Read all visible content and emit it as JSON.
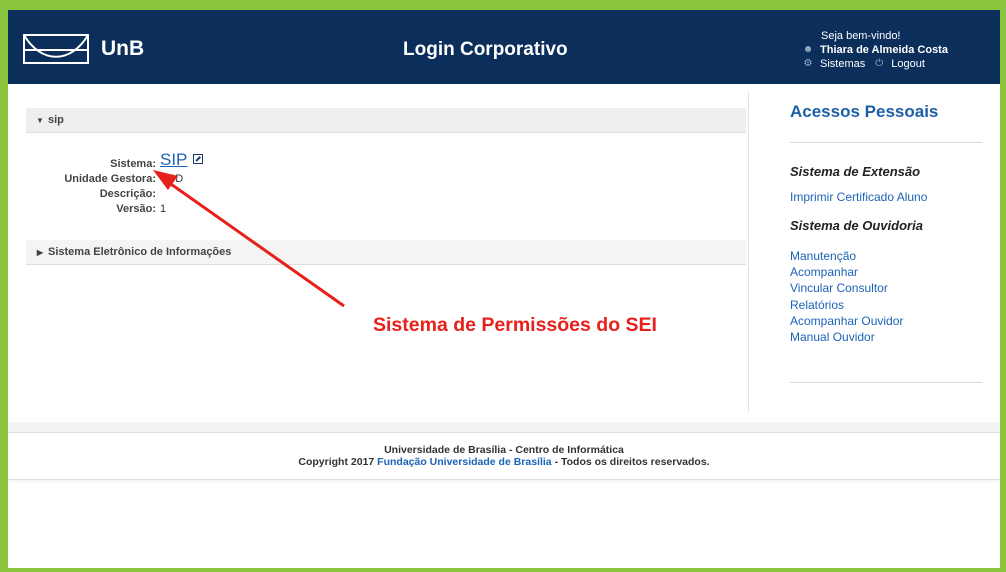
{
  "header": {
    "logo_text": "UnB",
    "title": "Login Corporativo",
    "welcome": "Seja bem-vindo!",
    "user_name": "Thiara de Almeida Costa",
    "sistemas_label": "Sistemas",
    "logout_label": "Logout"
  },
  "main": {
    "section1": {
      "label": "sip",
      "expanded": true
    },
    "fields": {
      "sistema_label": "Sistema:",
      "sistema_value": "SIP",
      "unidade_label": "Unidade Gestora:",
      "unidade_value": "CPD",
      "descricao_label": "Descrição:",
      "descricao_value": "",
      "versao_label": "Versão:",
      "versao_value": "1"
    },
    "section2": {
      "label": "Sistema Eletrônico de Informações",
      "expanded": false
    }
  },
  "sidebar": {
    "title": "Acessos Pessoais",
    "groups": [
      {
        "title": "Sistema de Extensão",
        "links": [
          "Imprimir Certificado Aluno"
        ]
      },
      {
        "title": "Sistema de Ouvidoria",
        "links": [
          "Manutenção",
          "Acompanhar",
          "Vincular Consultor",
          "Relatórios",
          "Acompanhar Ouvidor",
          "Manual Ouvidor"
        ]
      }
    ]
  },
  "footer": {
    "line1": "Universidade de Brasília - Centro de Informática",
    "line2_prefix": "Copyright 2017",
    "line2_link": "Fundação Universidade de Brasília",
    "line2_suffix": "- Todos os direitos reservados."
  },
  "annotation": {
    "text": "Sistema de Permissões do SEI",
    "color": "#e8201b"
  },
  "colors": {
    "header_bg": "#0b2e5b",
    "frame_border": "#8cc63f",
    "link": "#1c63b7",
    "sidebar_title": "#1d5fa5"
  }
}
